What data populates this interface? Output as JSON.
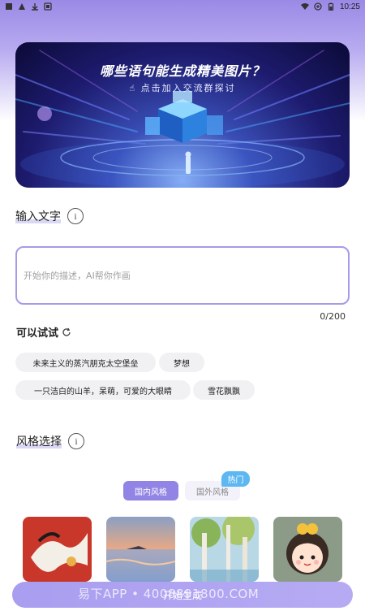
{
  "status_bar": {
    "time": "10:25",
    "icons": [
      "signal-warning-icon",
      "download-icon",
      "app-notification-icon",
      "wifi-icon",
      "battery-saver-icon",
      "battery-icon"
    ]
  },
  "banner": {
    "title": "哪些语句能生成精美图片？",
    "subtitle": "点击加入交流群探讨"
  },
  "input_section": {
    "label": "输入文字",
    "placeholder": "开始你的描述，AI帮你作画",
    "counter": "0/200"
  },
  "try_section": {
    "label": "可以试试",
    "chips": [
      "未来主义的蒸汽朋克太空堡垒",
      "梦想",
      "一只洁白的山羊，呆萌，可爱的大眼睛",
      "雪花飘飘"
    ]
  },
  "style_section": {
    "label": "风格选择",
    "tabs": [
      "国内风格",
      "国外风格"
    ],
    "badge": "热门"
  },
  "bottom": {
    "button_label": "开始生成",
    "watermark": "易下APP • 4008891800.COM"
  },
  "colors": {
    "accent": "#9085e4",
    "badge": "#5db7f0",
    "input_border": "#a79ae8"
  }
}
